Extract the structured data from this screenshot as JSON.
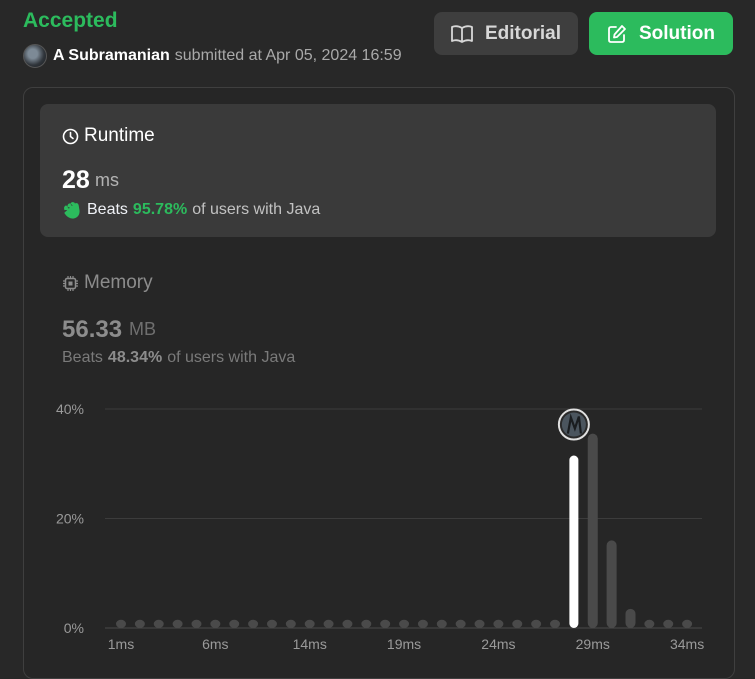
{
  "header": {
    "status": "Accepted",
    "submitter_name": "A Subramanian",
    "submitted_text": "submitted at Apr 05, 2024 16:59",
    "editorial_label": "Editorial",
    "solution_label": "Solution"
  },
  "runtime": {
    "title": "Runtime",
    "value": "28",
    "unit": "ms",
    "beats_label": "Beats",
    "beats_pct": "95.78%",
    "beats_suffix": "of users with Java"
  },
  "memory": {
    "title": "Memory",
    "value": "56.33",
    "unit": "MB",
    "beats_label": "Beats",
    "beats_pct": "48.34%",
    "beats_suffix": "of users with Java"
  },
  "colors": {
    "accent_green": "#2cbb5d",
    "background": "#282828",
    "panel": "#3a3a3a",
    "bar_selected": "#ffffff",
    "bar_default": "#4a4a4a"
  },
  "chart_data": {
    "type": "bar",
    "xlabel": "",
    "ylabel": "",
    "ylim": [
      0,
      40
    ],
    "y_ticks": [
      "0%",
      "20%",
      "40%"
    ],
    "x_tick_labels": [
      "1ms",
      "6ms",
      "14ms",
      "19ms",
      "24ms",
      "29ms",
      "34ms"
    ],
    "x_tick_indices": [
      0,
      5,
      10,
      15,
      20,
      25,
      30
    ],
    "grid": true,
    "selected_index": 24,
    "values": [
      1.5,
      1.5,
      1.5,
      1.5,
      1.5,
      1.5,
      1.5,
      1.5,
      1.5,
      1.5,
      1.5,
      1.5,
      1.5,
      1.5,
      1.5,
      1.5,
      1.5,
      1.5,
      1.5,
      1.5,
      1.5,
      1.5,
      1.5,
      1.5,
      31.5,
      35.5,
      16,
      3.5,
      1.5,
      1.5,
      1.5
    ]
  }
}
